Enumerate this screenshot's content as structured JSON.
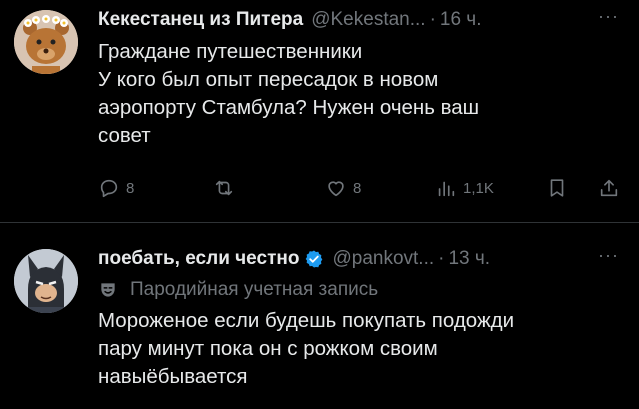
{
  "tweet1": {
    "author_name": "Кекестанец из Питера",
    "handle": "@Kekestan...",
    "dot": "·",
    "time": "16 ч.",
    "more": "···",
    "text": "Граждане путешественники\nУ кого был опыт пересадок в новом\nаэропорту Стамбула? Нужен очень ваш\nсовет",
    "replies": "8",
    "likes": "8",
    "views": "1,1K"
  },
  "tweet2": {
    "author_name": "поебать, если честно",
    "handle": "@pankovt...",
    "dot": "·",
    "time": "13 ч.",
    "more": "···",
    "parody_label": "Пародийная учетная запись",
    "text": "Мороженое если будешь покупать подожди\nпару минут пока он с рожком своим\nнавыёбывается"
  },
  "colors": {
    "background": "#000000",
    "text": "#e7e9ea",
    "muted": "#71767b",
    "verified": "#1d9bf0"
  },
  "icons": [
    "reply-icon",
    "retweet-icon",
    "like-icon",
    "views-icon",
    "bookmark-icon",
    "share-icon",
    "verified-badge-icon",
    "parody-mask-icon"
  ]
}
